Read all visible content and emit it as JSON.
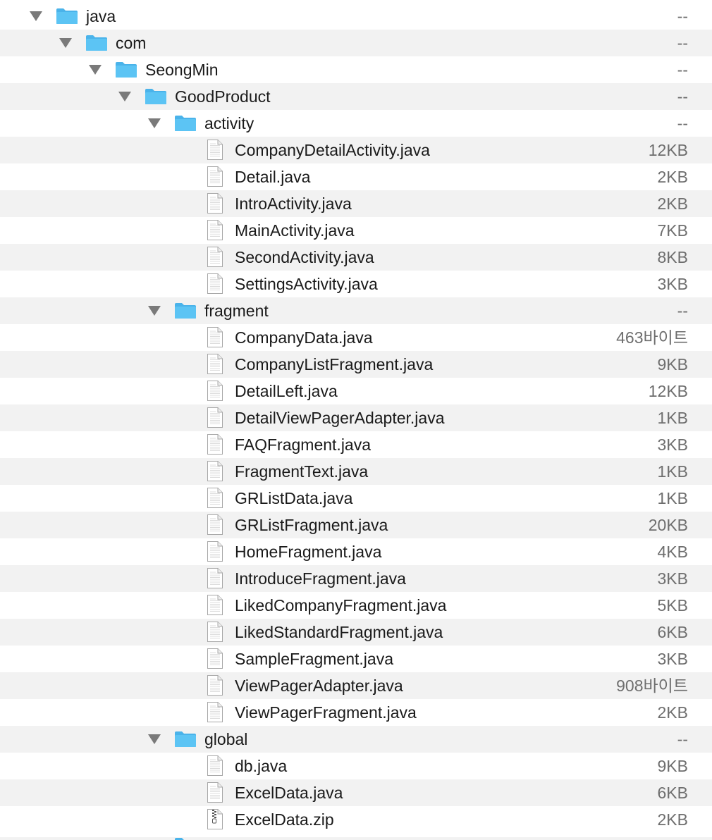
{
  "colors": {
    "folder": "#5cc4f4",
    "folder_tab": "#4ab3ea",
    "disclosure": "#7a7a7a",
    "row_alt": "#f2f2f2",
    "size_text": "#6e6e6e"
  },
  "rows": [
    {
      "name": "java",
      "size": "--",
      "type": "folder",
      "depth": 0
    },
    {
      "name": "com",
      "size": "--",
      "type": "folder",
      "depth": 1
    },
    {
      "name": "SeongMin",
      "size": "--",
      "type": "folder",
      "depth": 2
    },
    {
      "name": "GoodProduct",
      "size": "--",
      "type": "folder",
      "depth": 3
    },
    {
      "name": "activity",
      "size": "--",
      "type": "folder",
      "depth": 4
    },
    {
      "name": "CompanyDetailActivity.java",
      "size": "12KB",
      "type": "file",
      "depth": 5
    },
    {
      "name": "Detail.java",
      "size": "2KB",
      "type": "file",
      "depth": 5
    },
    {
      "name": "IntroActivity.java",
      "size": "2KB",
      "type": "file",
      "depth": 5
    },
    {
      "name": "MainActivity.java",
      "size": "7KB",
      "type": "file",
      "depth": 5
    },
    {
      "name": "SecondActivity.java",
      "size": "8KB",
      "type": "file",
      "depth": 5
    },
    {
      "name": "SettingsActivity.java",
      "size": "3KB",
      "type": "file",
      "depth": 5
    },
    {
      "name": "fragment",
      "size": "--",
      "type": "folder",
      "depth": 4
    },
    {
      "name": "CompanyData.java",
      "size": "463바이트",
      "type": "file",
      "depth": 5
    },
    {
      "name": "CompanyListFragment.java",
      "size": "9KB",
      "type": "file",
      "depth": 5
    },
    {
      "name": "DetailLeft.java",
      "size": "12KB",
      "type": "file",
      "depth": 5
    },
    {
      "name": "DetailViewPagerAdapter.java",
      "size": "1KB",
      "type": "file",
      "depth": 5
    },
    {
      "name": "FAQFragment.java",
      "size": "3KB",
      "type": "file",
      "depth": 5
    },
    {
      "name": "FragmentText.java",
      "size": "1KB",
      "type": "file",
      "depth": 5
    },
    {
      "name": "GRListData.java",
      "size": "1KB",
      "type": "file",
      "depth": 5
    },
    {
      "name": "GRListFragment.java",
      "size": "20KB",
      "type": "file",
      "depth": 5
    },
    {
      "name": "HomeFragment.java",
      "size": "4KB",
      "type": "file",
      "depth": 5
    },
    {
      "name": "IntroduceFragment.java",
      "size": "3KB",
      "type": "file",
      "depth": 5
    },
    {
      "name": "LikedCompanyFragment.java",
      "size": "5KB",
      "type": "file",
      "depth": 5
    },
    {
      "name": "LikedStandardFragment.java",
      "size": "6KB",
      "type": "file",
      "depth": 5
    },
    {
      "name": "SampleFragment.java",
      "size": "3KB",
      "type": "file",
      "depth": 5
    },
    {
      "name": "ViewPagerAdapter.java",
      "size": "908바이트",
      "type": "file",
      "depth": 5
    },
    {
      "name": "ViewPagerFragment.java",
      "size": "2KB",
      "type": "file",
      "depth": 5
    },
    {
      "name": "global",
      "size": "--",
      "type": "folder",
      "depth": 4
    },
    {
      "name": "db.java",
      "size": "9KB",
      "type": "file",
      "depth": 5
    },
    {
      "name": "ExcelData.java",
      "size": "6KB",
      "type": "file",
      "depth": 5
    },
    {
      "name": "ExcelData.zip",
      "size": "2KB",
      "type": "zip",
      "depth": 5
    }
  ]
}
